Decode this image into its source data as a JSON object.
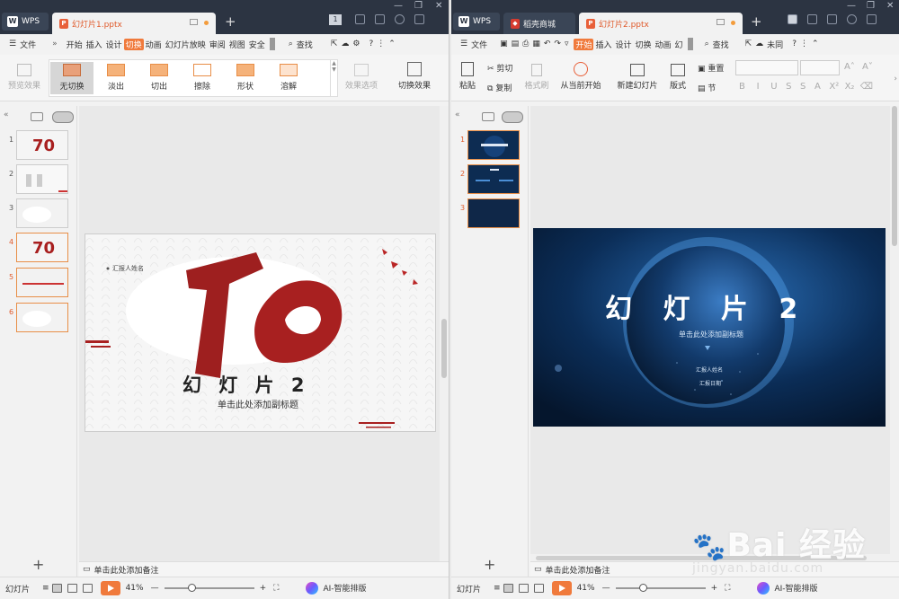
{
  "left": {
    "wps_tab": "WPS",
    "doc_tab": "幻灯片1.pptx",
    "badge": "1",
    "menu": {
      "file": "文件",
      "more": "»",
      "items": [
        "开始",
        "插入",
        "设计",
        "切换",
        "动画",
        "幻灯片放映",
        "审阅",
        "视图",
        "安全",
        "≫"
      ],
      "active": "切换",
      "search": "查找"
    },
    "ribbon": {
      "preview": "预览效果",
      "transitions": [
        "无切换",
        "淡出",
        "切出",
        "擦除",
        "形状",
        "溶解"
      ],
      "selected": "无切换",
      "options": "效果选项",
      "switch_effect": "切换效果"
    },
    "thumbs": [
      "1",
      "2",
      "3",
      "4",
      "5",
      "6"
    ],
    "slide": {
      "bullet": "汇报人姓名",
      "title": "幻 灯 片 2",
      "subtitle": "单击此处添加副标题"
    },
    "notes": "单击此处添加备注",
    "status": {
      "label": "幻灯片",
      "zoom": "41%",
      "minus": "—",
      "plus": "+",
      "ai": "AI-智能排版"
    }
  },
  "right": {
    "wps_tab": "WPS",
    "tab2": "稻壳商城",
    "doc_tab": "幻灯片2.pptx",
    "menu": {
      "file": "文件",
      "active": "开始",
      "items": [
        "开始",
        "插入",
        "设计",
        "切换",
        "动画",
        "幻"
      ],
      "search": "查找",
      "sync": "未同"
    },
    "ribbon": {
      "cut": "剪切",
      "paste": "粘贴",
      "copy": "复制",
      "format": "格式刷",
      "from_start": "从当前开始",
      "new_slide": "新建幻灯片",
      "layout": "版式",
      "reset": "重置",
      "section": "节"
    },
    "thumbs": [
      "1",
      "2",
      "3"
    ],
    "slide": {
      "title": "幻 灯 片 2",
      "subtitle": "单击此处添加副标题",
      "reporter": "汇报人姓名",
      "date": "汇报日期"
    },
    "notes": "单击此处添加备注",
    "status": {
      "label": "幻灯片",
      "zoom": "41%",
      "minus": "—",
      "plus": "+",
      "ai": "AI-智能排版"
    }
  },
  "watermark": {
    "brand": "Bai 经验",
    "url": "jingyan.baidu.com"
  }
}
